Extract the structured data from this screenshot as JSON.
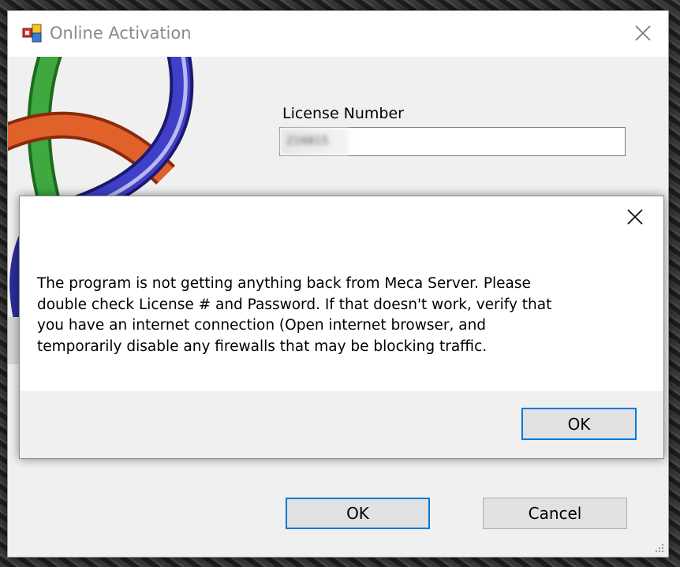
{
  "window": {
    "title": "Online Activation",
    "icons": {
      "app": "app-icon",
      "close": "close-icon"
    }
  },
  "form": {
    "license_label": "License Number",
    "license_value": "216815"
  },
  "buttons": {
    "ok": "OK",
    "cancel": "Cancel"
  },
  "message_box": {
    "text": "The program is not getting anything back from Meca Server.  Please\ndouble check License # and Password.  If that doesn't work, verify that\nyou have an internet connection (Open internet browser, and\ntemporarily disable any firewalls that may be blocking traffic.",
    "ok": "OK",
    "icons": {
      "close": "close-icon"
    }
  },
  "colors": {
    "accent": "#0078d7",
    "titlebar_text": "#8a8a8a",
    "window_bg": "#f0f0f0",
    "button_bg": "#e1e1e1"
  }
}
